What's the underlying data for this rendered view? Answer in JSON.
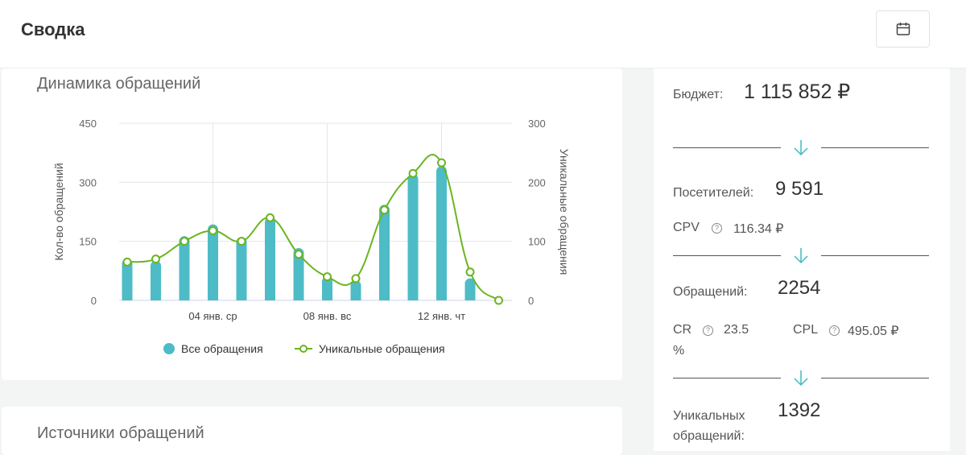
{
  "header": {
    "title": "Сводка",
    "calendar_icon": "calendar-icon"
  },
  "dynamics": {
    "title": "Динамика обращений"
  },
  "sources": {
    "title": "Источники обращений"
  },
  "chart_data": {
    "type": "bar+line",
    "title": "Динамика обращений",
    "x": [
      1,
      2,
      3,
      4,
      5,
      6,
      7,
      8,
      9,
      10,
      11,
      12,
      13,
      14
    ],
    "tick_labels": [
      {
        "x": 4,
        "label": "04 янв. ср"
      },
      {
        "x": 8,
        "label": "08 янв. вс"
      },
      {
        "x": 12,
        "label": "12 янв. чт"
      }
    ],
    "ylabel": "Кол-во обращений",
    "ylim": [
      0,
      450
    ],
    "yticks": [
      "0",
      "150",
      "300",
      "450"
    ],
    "y2label": "Уникальные обращения",
    "y2lim": [
      0,
      300
    ],
    "y2ticks": [
      "0",
      "100",
      "200",
      "300"
    ],
    "series": [
      {
        "name": "Все обращения",
        "type": "bar",
        "axis": "left",
        "color": "#4dbcc6",
        "values": [
          105,
          100,
          162,
          192,
          160,
          210,
          132,
          60,
          50,
          242,
          320,
          340,
          55,
          0
        ]
      },
      {
        "name": "Уникальные обращения",
        "type": "line",
        "axis": "right",
        "color": "#6ab521",
        "values": [
          65,
          70,
          100,
          118,
          100,
          140,
          78,
          40,
          37,
          153,
          215,
          233,
          48,
          0
        ]
      }
    ],
    "legend": "bottom",
    "grid": true
  },
  "stats": {
    "budget_label": "Бюджет:",
    "budget_value": "1 115 852 ₽",
    "visitors_label": "Посетителей:",
    "visitors_value": "9 591",
    "cpv_label": "CPV",
    "cpv_value": "116.34 ₽",
    "leads_label": "Обращений:",
    "leads_value": "2254",
    "cr_label": "CR",
    "cr_value": "23.5",
    "cr_unit": "%",
    "cpl_label": "CPL",
    "cpl_value": "495.05 ₽",
    "unique_label_1": "Уникальных",
    "unique_label_2": "обращений:",
    "unique_value": "1392",
    "help": "?",
    "arrow_color": "#3fb8c4"
  }
}
